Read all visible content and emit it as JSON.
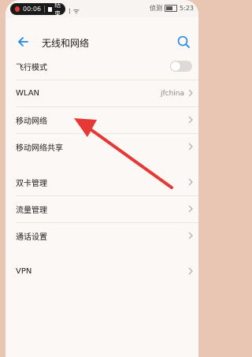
{
  "status": {
    "record_time": "00:06",
    "record_stop": "结束",
    "carrier_signal": "… ▥",
    "carrier": "… 侦录",
    "time": "5:23"
  },
  "header": {
    "title": "无线和网络"
  },
  "settings": {
    "airplane": "飞行模式",
    "wlan": "WLAN",
    "wlan_value": "jfchina",
    "mobile_network": "移动网络",
    "tethering": "移动网络共享",
    "dual_sim": "双卡管理",
    "data_usage": "流量管理",
    "call_settings": "通话设置",
    "vpn": "VPN"
  },
  "colors": {
    "accent": "#1e88e5",
    "annotation_arrow": "#e53935"
  }
}
